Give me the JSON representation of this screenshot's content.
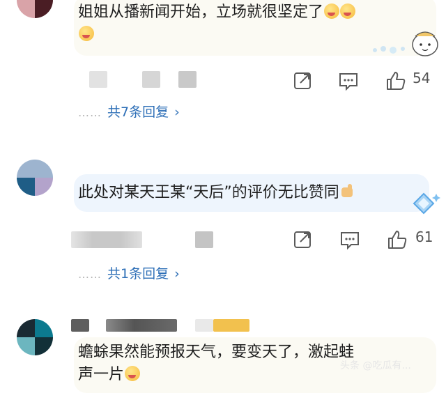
{
  "comments": [
    {
      "text": "姐姐从播新闻开始，立场就很坚定了",
      "actions": {
        "like_count": "54"
      },
      "replies_label": "共7条回复"
    },
    {
      "text": "此处对某天王某“天后”的评价无比赞同",
      "actions": {
        "like_count": "61"
      },
      "replies_label": "共1条回复"
    },
    {
      "text_line1": "蟾蜍果然能预报天气，要变天了，激起蛙",
      "text_line2": "声一片"
    }
  ],
  "reply_dots": "……",
  "reply_chevron": "›",
  "watermark": "头条 @吃瓜有...",
  "icons": {
    "share": "share-icon",
    "comment": "comment-icon",
    "like": "like-icon",
    "chevron": "chevron-right-icon"
  },
  "colors": {
    "link": "#2e6fb7",
    "bubble": "#fbfaf3",
    "bubble_blue": "#eef5fd",
    "icon": "#5a5a5a"
  }
}
